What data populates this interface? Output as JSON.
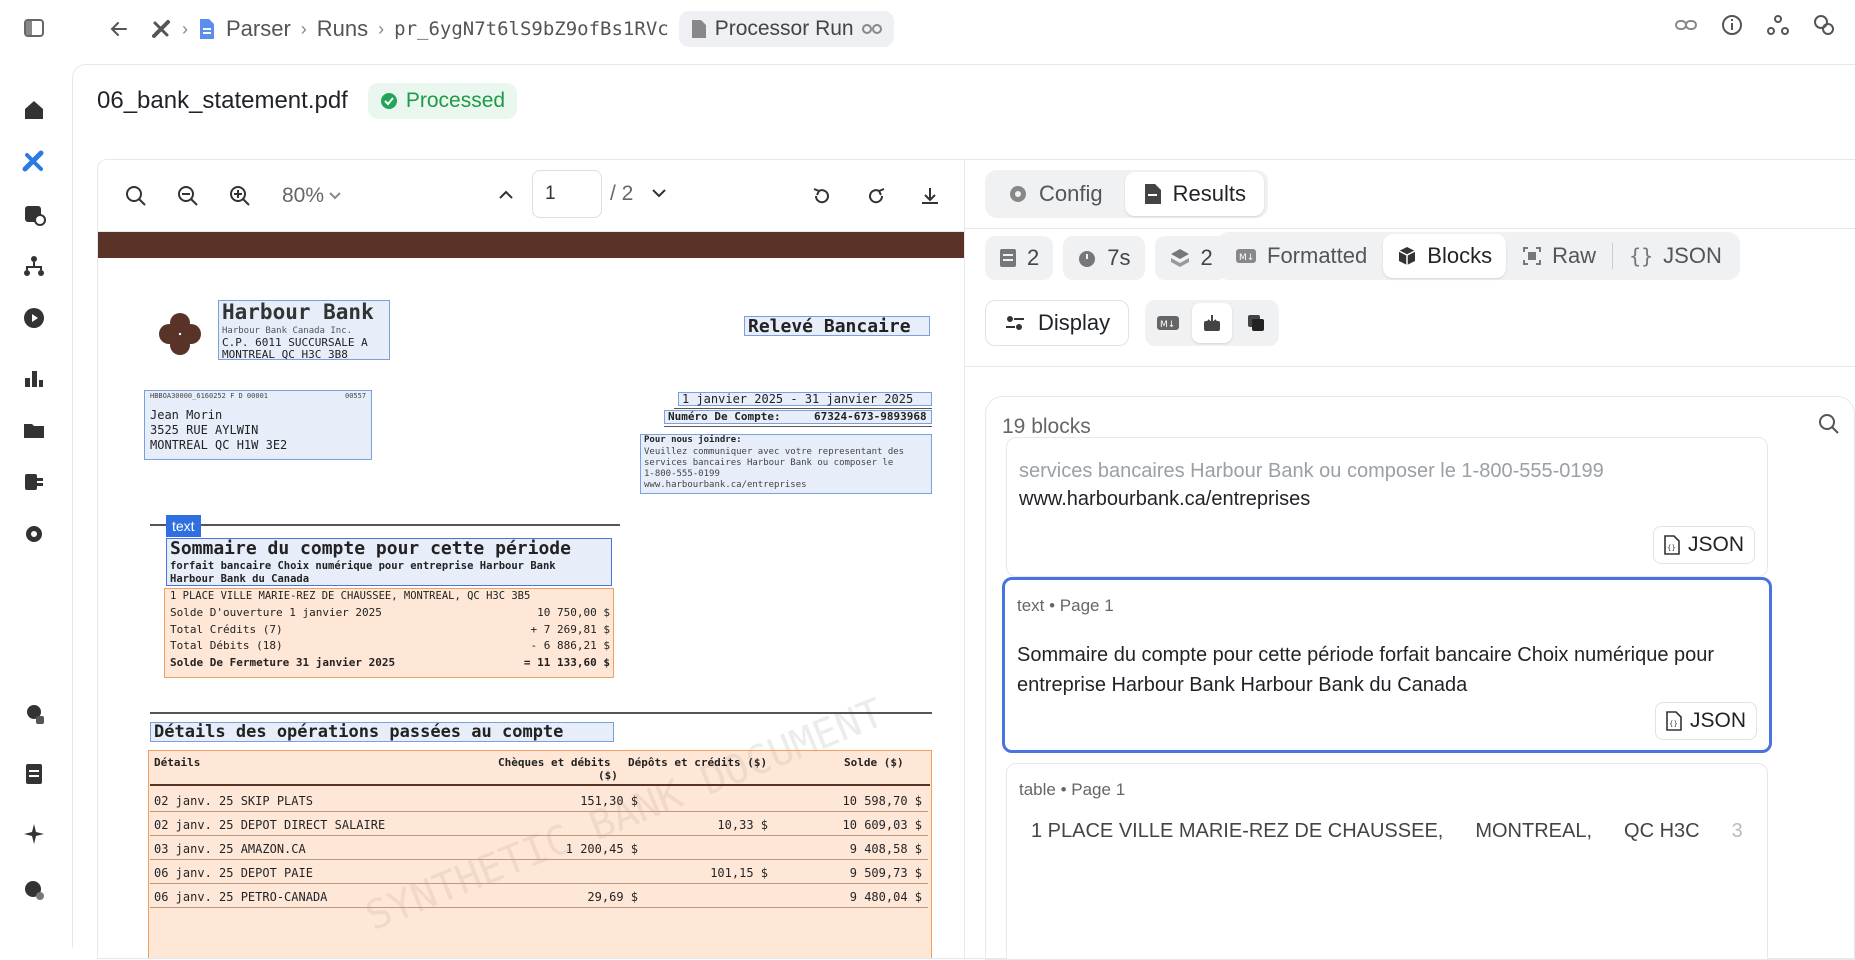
{
  "breadcrumb": {
    "parser": "Parser",
    "runs": "Runs",
    "run_id": "pr_6ygN7t6lS9bZ9ofBs1RVc",
    "chip": "Processor Run"
  },
  "file": {
    "name": "06_bank_statement.pdf",
    "status": "Processed"
  },
  "viewer": {
    "zoom": "80%",
    "page_current": "1",
    "page_total": "/ 2"
  },
  "doc": {
    "bank_name": "Harbour Bank",
    "bank_sub": "Harbour Bank Canada Inc.",
    "bank_addr1": "C.P. 6011 SUCCURSALE A",
    "bank_addr2": "MONTREAL QC  H3C 3B8",
    "statement_title": "Relevé Bancaire",
    "barcode_line": "HBBOA30000_6160252 F  D  00001",
    "barcode_num": "00557",
    "client_name": "Jean Morin",
    "client_addr1": "3525 RUE AYLWIN",
    "client_addr2": "MONTREAL QC  H1W 3E2",
    "period": "1 janvier 2025 - 31 janvier 2025",
    "account_label": "Numéro De Compte:",
    "account_number": "67324-673-9893968",
    "contact_title": "Pour nous joindre:",
    "contact_l1": "Veuillez communiquer avec votre representant des",
    "contact_l2": "services bancaires Harbour Bank ou composer le",
    "contact_l3": "1-800-555-0199",
    "contact_l4": "www.harbourbank.ca/entreprises",
    "tag": "text",
    "summary_title": "Sommaire du compte pour cette période",
    "summary_sub1": "forfait bancaire Choix numérique pour entreprise Harbour Bank",
    "summary_sub2": "Harbour Bank du Canada",
    "summary_addr": "1 PLACE VILLE MARIE-REZ DE CHAUSSEE, MONTREAL, QC  H3C 3B5",
    "summary_rows": [
      {
        "label": "Solde D'ouverture 1 janvier 2025",
        "value": "10 750,00 $"
      },
      {
        "label": "Total Crédits (7)",
        "value": "+ 7 269,81 $"
      },
      {
        "label": "Total Débits (18)",
        "value": "- 6 886,21 $"
      },
      {
        "label": "Solde De Fermeture 31 janvier 2025",
        "value": "= 11 133,60 $"
      }
    ],
    "details_title": "Détails des opérations passées au compte",
    "table_headers": {
      "details": "Détails",
      "debits": "Chèques et débits",
      "debits2": "($)",
      "credits": "Dépôts et crédits ($)",
      "balance": "Solde ($)"
    },
    "rows": [
      {
        "desc": "02 janv. 25 SKIP PLATS",
        "debit": "151,30 $",
        "credit": "",
        "balance": "10 598,70 $"
      },
      {
        "desc": "02 janv. 25 DEPOT DIRECT SALAIRE",
        "debit": "",
        "credit": "10,33 $",
        "balance": "10 609,03 $"
      },
      {
        "desc": "03 janv. 25 AMAZON.CA",
        "debit": "1 200,45 $",
        "credit": "",
        "balance": "9 408,58 $"
      },
      {
        "desc": "06 janv. 25 DEPOT PAIE",
        "debit": "",
        "credit": "101,15 $",
        "balance": "9 509,73 $"
      },
      {
        "desc": "06 janv. 25 PETRO-CANADA",
        "debit": "29,69 $",
        "credit": "",
        "balance": "9 480,04 $"
      }
    ],
    "watermark": "SYNTHETIC BANK DOCUMENT"
  },
  "panel": {
    "tab_config": "Config",
    "tab_results": "Results",
    "stat_pages": "2",
    "stat_time": "7s",
    "stat_blocks": "2",
    "view_formatted": "Formatted",
    "view_blocks": "Blocks",
    "view_raw": "Raw",
    "view_json": "JSON",
    "display": "Display",
    "blocks_count": "19 blocks",
    "cards": [
      {
        "line_faded": "services bancaires Harbour Bank ou composer le 1-800-555-0199",
        "text": "www.harbourbank.ca/entreprises",
        "json": "JSON"
      },
      {
        "meta": "text • Page 1",
        "text": "Sommaire du compte pour cette période forfait bancaire Choix numérique pour entreprise Harbour Bank Harbour Bank du Canada",
        "json": "JSON"
      },
      {
        "meta": "table • Page 1",
        "cells": [
          "1 PLACE VILLE MARIE-REZ DE CHAUSSEE,",
          "MONTREAL,",
          "QC H3C",
          "3"
        ]
      }
    ]
  }
}
